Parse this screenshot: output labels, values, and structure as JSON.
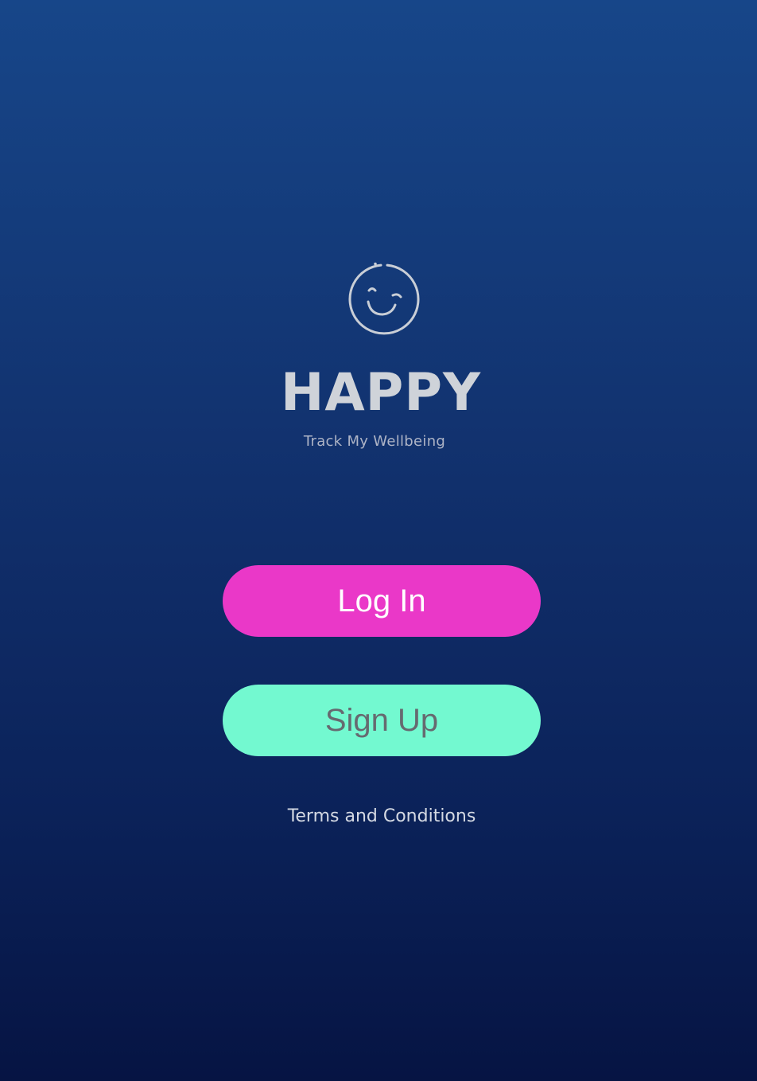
{
  "app": {
    "name": "HAPPY",
    "tagline": "Track My Wellbeing",
    "logo_icon": "winking-smiley-icon"
  },
  "actions": {
    "login_label": "Log In",
    "signup_label": "Sign Up",
    "terms_label": "Terms and Conditions"
  },
  "colors": {
    "background_top": "#174689",
    "background_bottom": "#061443",
    "login_button": "#ea38c8",
    "signup_button": "#73f9d0",
    "title_text": "#cfd3d9"
  }
}
